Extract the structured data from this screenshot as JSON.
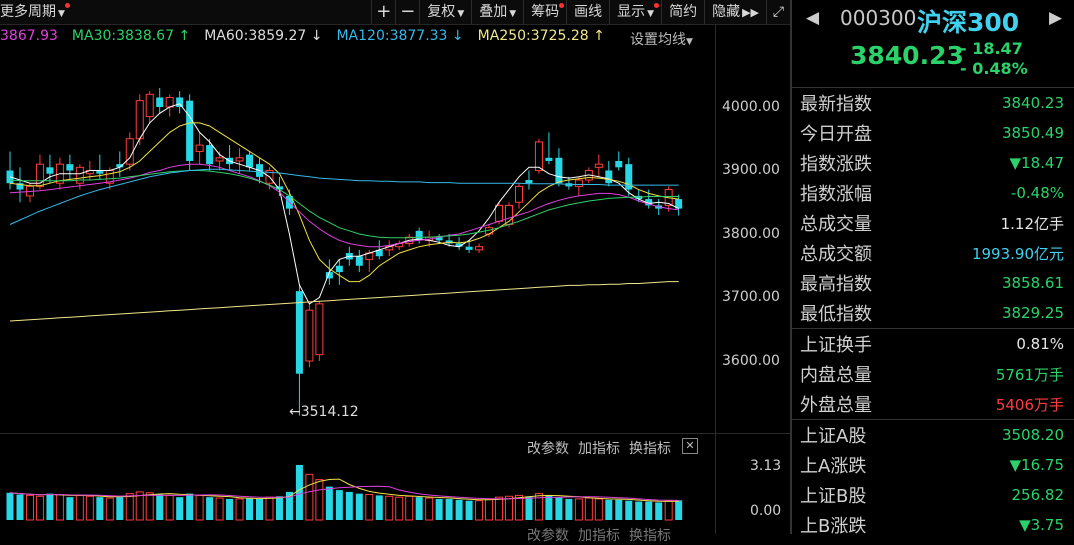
{
  "toolbar": {
    "period_label": "更多周期",
    "plus": "+",
    "minus": "−",
    "fuquan": "复权",
    "overlay": "叠加",
    "chips": "筹码",
    "line": "画线",
    "display": "显示",
    "simple": "简约",
    "hide": "隐藏",
    "expand_icon": "expand-icon"
  },
  "ma_bar": {
    "ma_partial": "3867.93",
    "ma30": "MA30:3838.67",
    "ma60": "MA60:3859.27",
    "ma120": "MA120:3877.33",
    "ma250": "MA250:3725.28",
    "settings": "设置均线",
    "colors": {
      "partial": "#e040e0",
      "ma30": "#2bd26a",
      "ma60": "#dddddd",
      "ma120": "#35b8e8",
      "ma250": "#f0e68c"
    }
  },
  "price_axis": [
    "4000.00",
    "3900.00",
    "3800.00",
    "3700.00",
    "3600.00"
  ],
  "low_marker": "3514.12",
  "volume_panel": {
    "tools": [
      "改参数",
      "加指标",
      "换指标"
    ],
    "axis": [
      "3.13",
      "0.00"
    ]
  },
  "chart_data": {
    "type": "candlestick",
    "y_range": [
      3480,
      4040
    ],
    "candles": [
      [
        3900,
        3930,
        3870,
        3880
      ],
      [
        3880,
        3905,
        3850,
        3870
      ],
      [
        3860,
        3880,
        3850,
        3875
      ],
      [
        3875,
        3925,
        3870,
        3910
      ],
      [
        3905,
        3925,
        3880,
        3895
      ],
      [
        3880,
        3920,
        3870,
        3910
      ],
      [
        3910,
        3925,
        3885,
        3900
      ],
      [
        3880,
        3910,
        3870,
        3905
      ],
      [
        3895,
        3915,
        3885,
        3900
      ],
      [
        3900,
        3925,
        3885,
        3895
      ],
      [
        3880,
        3905,
        3870,
        3900
      ],
      [
        3910,
        3930,
        3890,
        3905
      ],
      [
        3910,
        3960,
        3900,
        3950
      ],
      [
        3950,
        4020,
        3940,
        4010
      ],
      [
        3985,
        4025,
        3975,
        4020
      ],
      [
        4015,
        4030,
        3990,
        4000
      ],
      [
        4000,
        4020,
        3985,
        4015
      ],
      [
        4015,
        4025,
        3990,
        4000
      ],
      [
        4010,
        4020,
        3900,
        3915
      ],
      [
        3930,
        3960,
        3910,
        3940
      ],
      [
        3940,
        3950,
        3900,
        3910
      ],
      [
        3915,
        3930,
        3900,
        3920
      ],
      [
        3920,
        3940,
        3900,
        3910
      ],
      [
        3915,
        3935,
        3895,
        3920
      ],
      [
        3925,
        3930,
        3900,
        3905
      ],
      [
        3910,
        3920,
        3880,
        3890
      ],
      [
        3880,
        3905,
        3870,
        3900
      ],
      [
        3875,
        3890,
        3860,
        3870
      ],
      [
        3860,
        3870,
        3830,
        3840
      ],
      [
        3710,
        3720,
        3514,
        3580
      ],
      [
        3600,
        3690,
        3590,
        3680
      ],
      [
        3610,
        3695,
        3600,
        3690
      ],
      [
        3740,
        3760,
        3720,
        3730
      ],
      [
        3750,
        3760,
        3720,
        3740
      ],
      [
        3770,
        3780,
        3750,
        3760
      ],
      [
        3765,
        3775,
        3740,
        3750
      ],
      [
        3760,
        3775,
        3740,
        3770
      ],
      [
        3775,
        3790,
        3760,
        3765
      ],
      [
        3775,
        3790,
        3765,
        3780
      ],
      [
        3780,
        3790,
        3775,
        3785
      ],
      [
        3785,
        3800,
        3780,
        3795
      ],
      [
        3805,
        3810,
        3785,
        3790
      ],
      [
        3790,
        3805,
        3780,
        3795
      ],
      [
        3795,
        3800,
        3785,
        3790
      ],
      [
        3790,
        3800,
        3780,
        3785
      ],
      [
        3785,
        3795,
        3775,
        3780
      ],
      [
        3780,
        3790,
        3770,
        3775
      ],
      [
        3775,
        3785,
        3770,
        3780
      ],
      [
        3800,
        3815,
        3795,
        3810
      ],
      [
        3820,
        3850,
        3815,
        3845
      ],
      [
        3815,
        3850,
        3810,
        3845
      ],
      [
        3850,
        3880,
        3840,
        3875
      ],
      [
        3885,
        3900,
        3870,
        3880
      ],
      [
        3900,
        3950,
        3895,
        3945
      ],
      [
        3920,
        3960,
        3910,
        3915
      ],
      [
        3920,
        3935,
        3875,
        3880
      ],
      [
        3880,
        3890,
        3870,
        3875
      ],
      [
        3875,
        3890,
        3860,
        3885
      ],
      [
        3885,
        3905,
        3880,
        3900
      ],
      [
        3905,
        3925,
        3890,
        3910
      ],
      [
        3900,
        3915,
        3875,
        3880
      ],
      [
        3915,
        3930,
        3900,
        3905
      ],
      [
        3910,
        3920,
        3860,
        3870
      ],
      [
        3860,
        3870,
        3850,
        3855
      ],
      [
        3855,
        3870,
        3840,
        3845
      ],
      [
        3845,
        3855,
        3830,
        3840
      ],
      [
        3845,
        3875,
        3835,
        3870
      ],
      [
        3855,
        3862,
        3829,
        3840
      ]
    ],
    "ma_lines": {
      "ma5": [
        3890,
        3885,
        3880,
        3880,
        3890,
        3895,
        3895,
        3895,
        3900,
        3900,
        3900,
        3905,
        3920,
        3950,
        3975,
        3990,
        4000,
        4005,
        3985,
        3960,
        3945,
        3925,
        3915,
        3910,
        3905,
        3900,
        3890,
        3870,
        3800,
        3720,
        3690,
        3700,
        3740,
        3760,
        3765,
        3765,
        3770,
        3775,
        3780,
        3785,
        3790,
        3792,
        3790,
        3787,
        3782,
        3780,
        3790,
        3805,
        3825,
        3850,
        3870,
        3890,
        3905,
        3905,
        3895,
        3890,
        3888,
        3890,
        3893,
        3890,
        3887,
        3880,
        3865,
        3855,
        3848,
        3850,
        3848,
        3840
      ],
      "ma10": [
        3880,
        3878,
        3876,
        3876,
        3880,
        3884,
        3886,
        3888,
        3890,
        3892,
        3895,
        3898,
        3905,
        3915,
        3930,
        3945,
        3960,
        3970,
        3975,
        3975,
        3970,
        3960,
        3950,
        3940,
        3930,
        3920,
        3910,
        3895,
        3865,
        3830,
        3790,
        3760,
        3745,
        3735,
        3725,
        3725,
        3735,
        3750,
        3760,
        3770,
        3775,
        3780,
        3783,
        3785,
        3787,
        3786,
        3788,
        3793,
        3800,
        3810,
        3820,
        3835,
        3850,
        3865,
        3875,
        3882,
        3885,
        3887,
        3889,
        3888,
        3886,
        3883,
        3878,
        3870,
        3864,
        3860,
        3857,
        3855
      ],
      "ma30": [
        3865,
        3866,
        3867,
        3868,
        3870,
        3872,
        3874,
        3876,
        3878,
        3880,
        3882,
        3885,
        3888,
        3892,
        3897,
        3900,
        3905,
        3908,
        3910,
        3910,
        3908,
        3905,
        3900,
        3895,
        3890,
        3884,
        3876,
        3866,
        3850,
        3835,
        3820,
        3808,
        3798,
        3790,
        3785,
        3782,
        3780,
        3780,
        3782,
        3785,
        3788,
        3790,
        3792,
        3795,
        3798,
        3800,
        3805,
        3810,
        3815,
        3820,
        3825,
        3830,
        3835,
        3842,
        3848,
        3853,
        3857,
        3860,
        3862,
        3864,
        3864,
        3862,
        3858,
        3852,
        3847,
        3843,
        3840,
        3838
      ],
      "ma60": [
        3885,
        3884,
        3884,
        3884,
        3884,
        3884,
        3884,
        3885,
        3885,
        3886,
        3887,
        3888,
        3890,
        3892,
        3894,
        3896,
        3898,
        3899,
        3900,
        3900,
        3899,
        3897,
        3895,
        3892,
        3888,
        3883,
        3877,
        3870,
        3860,
        3848,
        3836,
        3826,
        3818,
        3810,
        3805,
        3800,
        3797,
        3795,
        3794,
        3794,
        3794,
        3795,
        3795,
        3796,
        3797,
        3798,
        3800,
        3803,
        3806,
        3810,
        3815,
        3820,
        3826,
        3832,
        3838,
        3842,
        3846,
        3849,
        3852,
        3854,
        3856,
        3857,
        3858,
        3858,
        3859,
        3859,
        3859,
        3859
      ],
      "ma120": [
        3815,
        3822,
        3829,
        3836,
        3842,
        3848,
        3854,
        3860,
        3865,
        3870,
        3874,
        3878,
        3882,
        3886,
        3890,
        3893,
        3896,
        3898,
        3900,
        3901,
        3902,
        3902,
        3901,
        3900,
        3899,
        3898,
        3897,
        3896,
        3894,
        3892,
        3890,
        3888,
        3887,
        3886,
        3885,
        3884,
        3884,
        3883,
        3883,
        3882,
        3882,
        3882,
        3881,
        3881,
        3881,
        3880,
        3880,
        3880,
        3880,
        3880,
        3880,
        3880,
        3879,
        3879,
        3879,
        3879,
        3878,
        3878,
        3878,
        3878,
        3877,
        3877,
        3877,
        3877,
        3877,
        3877,
        3877,
        3877
      ],
      "ma250": [
        3663,
        3664,
        3665,
        3666,
        3667,
        3668,
        3669,
        3670,
        3671,
        3672,
        3673,
        3674,
        3675,
        3676,
        3677,
        3678,
        3679,
        3680,
        3681,
        3682,
        3683,
        3684,
        3685,
        3686,
        3687,
        3688,
        3689,
        3690,
        3691,
        3692,
        3693,
        3694,
        3695,
        3696,
        3697,
        3698,
        3699,
        3700,
        3701,
        3702,
        3703,
        3704,
        3705,
        3706,
        3707,
        3708,
        3709,
        3710,
        3711,
        3712,
        3713,
        3714,
        3715,
        3716,
        3717,
        3718,
        3719,
        3719,
        3720,
        3720,
        3721,
        3721,
        3722,
        3722,
        3723,
        3724,
        3725,
        3725
      ]
    },
    "volume": [
      1.55,
      1.45,
      1.4,
      1.35,
      1.5,
      1.45,
      1.3,
      1.4,
      1.35,
      1.3,
      1.25,
      1.3,
      1.5,
      1.6,
      1.55,
      1.45,
      1.4,
      1.3,
      1.5,
      1.4,
      1.3,
      1.25,
      1.2,
      1.2,
      1.25,
      1.2,
      1.3,
      1.35,
      1.6,
      3.13,
      2.6,
      2.3,
      1.9,
      1.7,
      1.6,
      1.5,
      1.45,
      1.4,
      1.35,
      1.3,
      1.35,
      1.3,
      1.25,
      1.2,
      1.2,
      1.15,
      1.1,
      1.1,
      1.2,
      1.3,
      1.35,
      1.4,
      1.35,
      1.5,
      1.4,
      1.3,
      1.2,
      1.2,
      1.25,
      1.2,
      1.15,
      1.15,
      1.1,
      1.05,
      1.05,
      1.0,
      1.1,
      1.12
    ],
    "vol_range": [
      0,
      3.13
    ]
  },
  "panel": {
    "code": "000300",
    "name": "沪深300",
    "price": "3840.23",
    "change": "- 18.47",
    "change_pct": "- 0.48%",
    "rows1": [
      {
        "label": "最新指数",
        "value": "3840.23",
        "color": "green"
      },
      {
        "label": "今日开盘",
        "value": "3850.49",
        "color": "green"
      },
      {
        "label": "指数涨跌",
        "value": "▼18.47",
        "color": "green"
      },
      {
        "label": "指数涨幅",
        "value": "-0.48%",
        "color": "green"
      },
      {
        "label": "总成交量",
        "value": "1.12亿手",
        "color": "white"
      },
      {
        "label": "总成交额",
        "value": "1993.90亿元",
        "color": "cyan"
      },
      {
        "label": "最高指数",
        "value": "3858.61",
        "color": "green"
      },
      {
        "label": "最低指数",
        "value": "3829.25",
        "color": "green"
      }
    ],
    "rows2": [
      {
        "label": "上证换手",
        "value": "0.81%",
        "color": "white"
      },
      {
        "label": "内盘总量",
        "value": "5761万手",
        "color": "green"
      },
      {
        "label": "外盘总量",
        "value": "5406万手",
        "color": "red"
      }
    ],
    "rows3": [
      {
        "label": "上证A股",
        "value": "3508.20",
        "color": "green"
      },
      {
        "label": "上A涨跌",
        "value": "▼16.75",
        "color": "green"
      },
      {
        "label": "上证B股",
        "value": "256.82",
        "color": "green"
      },
      {
        "label": "上B涨跌",
        "value": "▼3.75",
        "color": "green"
      }
    ]
  }
}
